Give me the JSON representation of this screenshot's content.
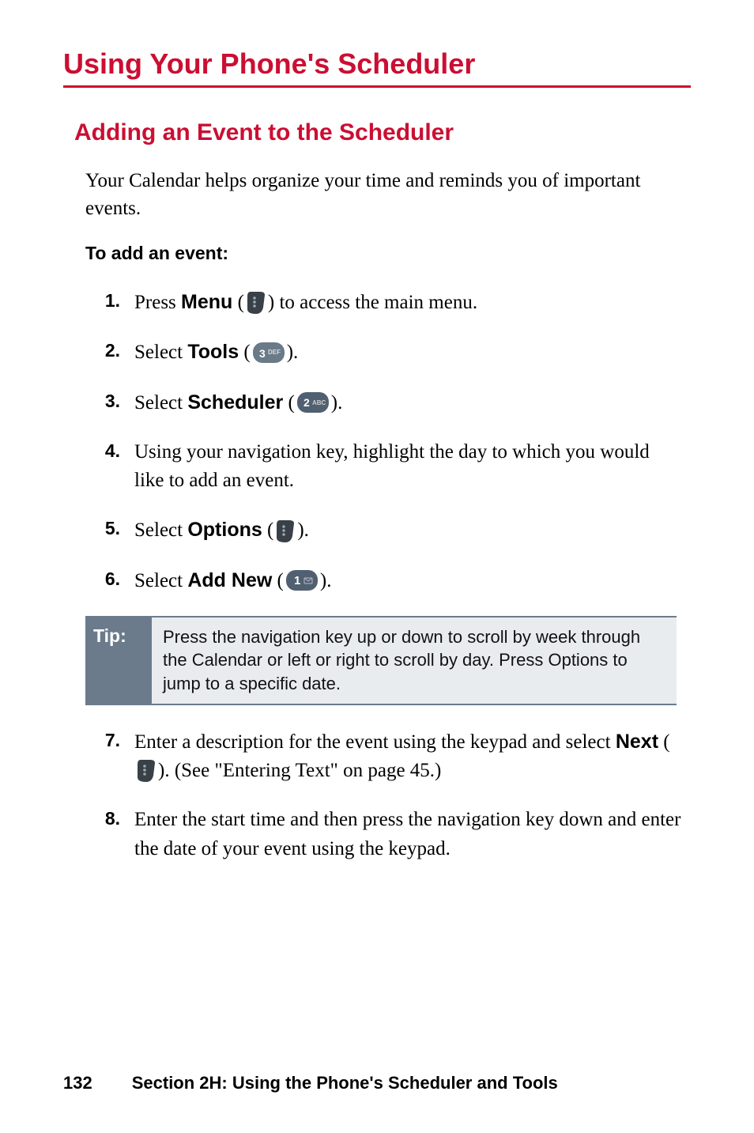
{
  "page_heading": "Using Your Phone's Scheduler",
  "section_heading": "Adding an Event to the Scheduler",
  "intro": "Your Calendar helps organize your time and reminds you of important events.",
  "sub_heading": "To add an event:",
  "steps": [
    {
      "num": "1.",
      "pre": "Press ",
      "bold": "Menu",
      "post": " to access the main menu.",
      "icon": "menu",
      "paren": true
    },
    {
      "num": "2.",
      "pre": "Select ",
      "bold": "Tools",
      "post": ".",
      "icon": "key3",
      "paren": true
    },
    {
      "num": "3.",
      "pre": "Select ",
      "bold": "Scheduler",
      "post": ".",
      "icon": "key2",
      "paren": true
    },
    {
      "num": "4.",
      "pre": "",
      "bold": "",
      "post": "Using your navigation key, highlight the day to which you would like to add an event.",
      "icon": "",
      "paren": false
    },
    {
      "num": "5.",
      "pre": "Select ",
      "bold": "Options",
      "post": ".",
      "icon": "softkey",
      "paren": true
    },
    {
      "num": "6.",
      "pre": "Select ",
      "bold": "Add New",
      "post": ".",
      "icon": "key1",
      "paren": true
    }
  ],
  "tip_label": "Tip:",
  "tip_content": "Press the navigation key up or down to scroll by week through the Calendar or left or right to scroll by day. Press Options to jump to a specific date.",
  "steps2": [
    {
      "num": "7.",
      "text_parts": [
        "Enter a description for the event using the keypad and select ",
        "Next",
        " (",
        "ICON_MENU",
        "). (See \"Entering Text\" on page 45.)"
      ]
    },
    {
      "num": "8.",
      "text": "Enter the start time and then press the navigation key down and enter the date of your event using the keypad."
    }
  ],
  "footer": {
    "page_number": "132",
    "section_label": "Section 2H: Using the Phone's Scheduler and Tools"
  }
}
